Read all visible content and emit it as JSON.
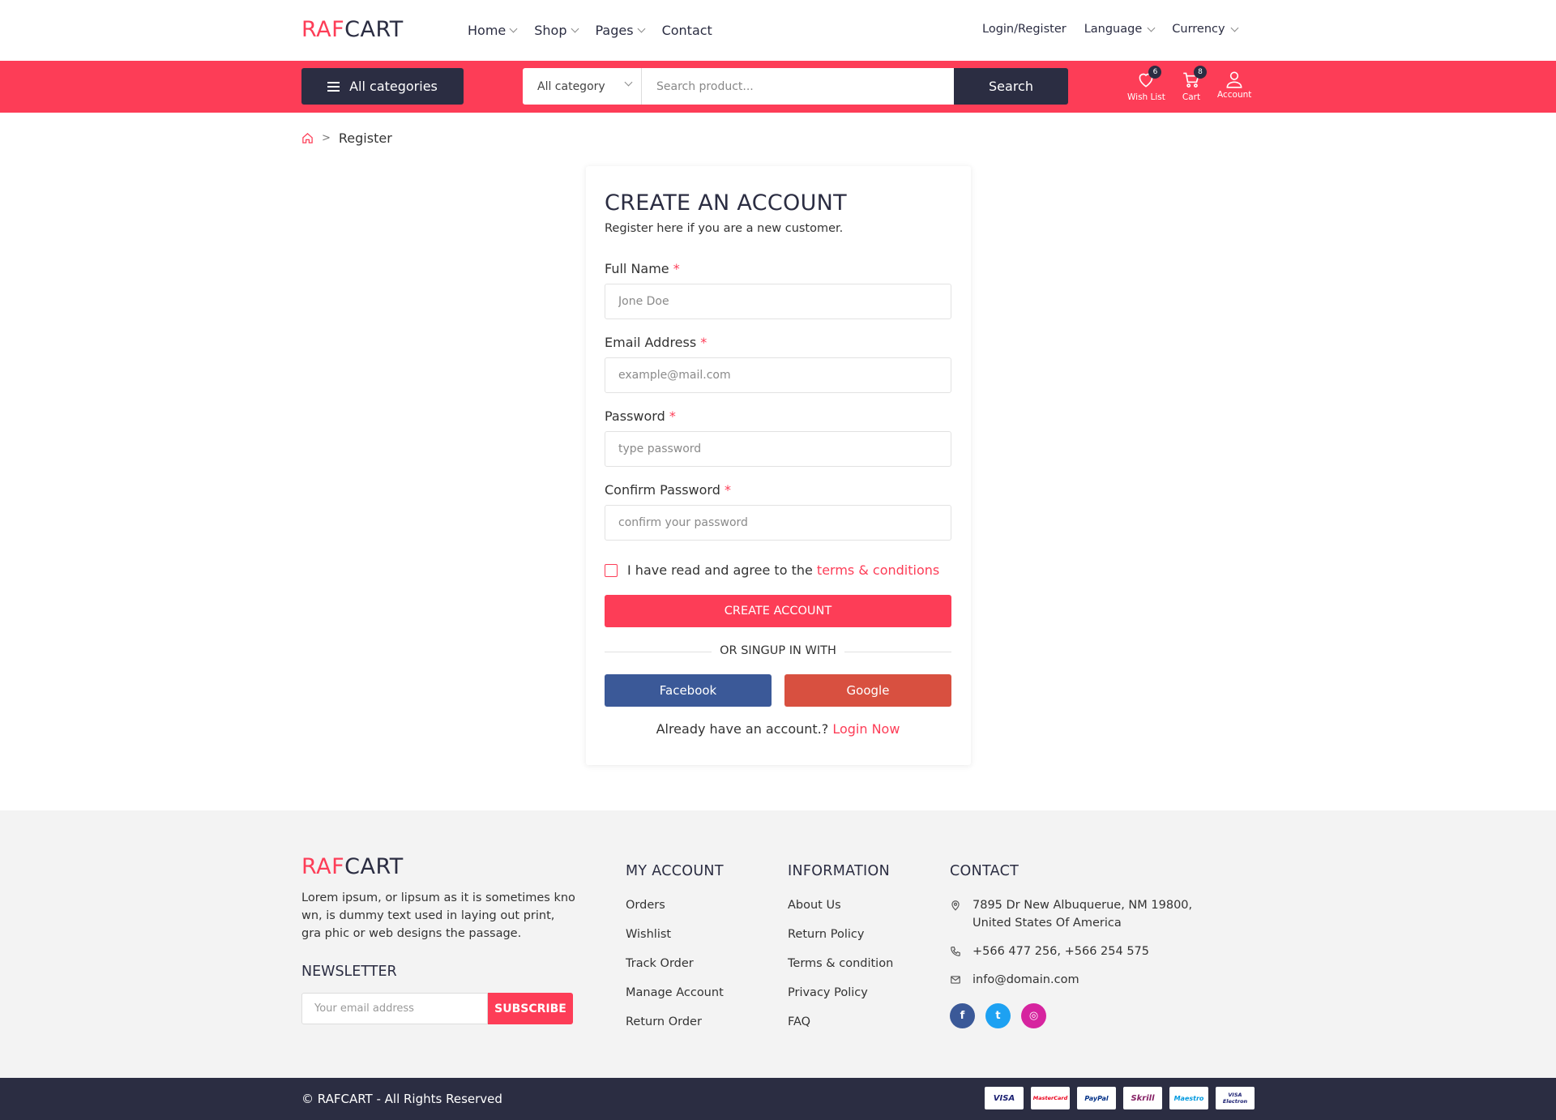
{
  "brand": {
    "part1": "RAF",
    "part2": "CART",
    "accent": "#fd3d57",
    "dark": "#2b2d42"
  },
  "nav": {
    "home": "Home",
    "shop": "Shop",
    "pages": "Pages",
    "contact": "Contact"
  },
  "topright": {
    "login": "Login/Register",
    "language": "Language",
    "currency": "Currency"
  },
  "searchbar": {
    "all_categories": "All categories",
    "category_select": "All category",
    "placeholder": "Search product...",
    "button": "Search"
  },
  "icons": {
    "wishlist": {
      "label": "Wish List",
      "count": "6",
      "icon": "heart-icon"
    },
    "cart": {
      "label": "Cart",
      "count": "8",
      "icon": "cart-icon"
    },
    "account": {
      "label": "Account",
      "icon": "user-icon"
    }
  },
  "breadcrumb": {
    "current": "Register"
  },
  "form": {
    "title": "CREATE AN ACCOUNT",
    "subtitle": "Register here if you are a new customer.",
    "required_mark": "*",
    "fullname_label": "Full Name",
    "fullname_placeholder": "Jone Doe",
    "email_label": "Email Address",
    "email_placeholder": "example@mail.com",
    "password_label": "Password",
    "password_placeholder": "type password",
    "confirm_label": "Confirm Password",
    "confirm_placeholder": "confirm your password",
    "agree_text": "I have read and agree to the",
    "agree_link": "terms & conditions",
    "create_button": "CREATE ACCOUNT",
    "or_text": "OR SINGUP IN WITH",
    "facebook": "Facebook",
    "google": "Google",
    "already_text": "Already have an account.?",
    "login_link": "Login Now"
  },
  "footer": {
    "description": "Lorem ipsum, or lipsum as it is sometimes kno wn, is dummy text used in laying out print, gra phic or web designs the passage.",
    "newsletter_title": "NEWSLETTER",
    "newsletter_placeholder": "Your email address",
    "subscribe": "SUBSCRIBE",
    "my_account": {
      "title": "MY ACCOUNT",
      "items": [
        "Orders",
        "Wishlist",
        "Track Order",
        "Manage Account",
        "Return Order"
      ]
    },
    "information": {
      "title": "INFORMATION",
      "items": [
        "About Us",
        "Return Policy",
        "Terms & condition",
        "Privacy Policy",
        "FAQ"
      ]
    },
    "contact": {
      "title": "CONTACT",
      "address": "7895 Dr New Albuquerue, NM 19800, United States Of America",
      "phone": "+566 477 256, +566 254 575",
      "email": "info@domain.com"
    },
    "social": {
      "facebook": "f",
      "twitter": "t",
      "instagram": "◎"
    },
    "copyright": "© RAFCART - All Rights Reserved",
    "payments": [
      "VISA",
      "MasterCard",
      "PayPal",
      "Skrill",
      "Maestro",
      "VISA Electron"
    ]
  }
}
